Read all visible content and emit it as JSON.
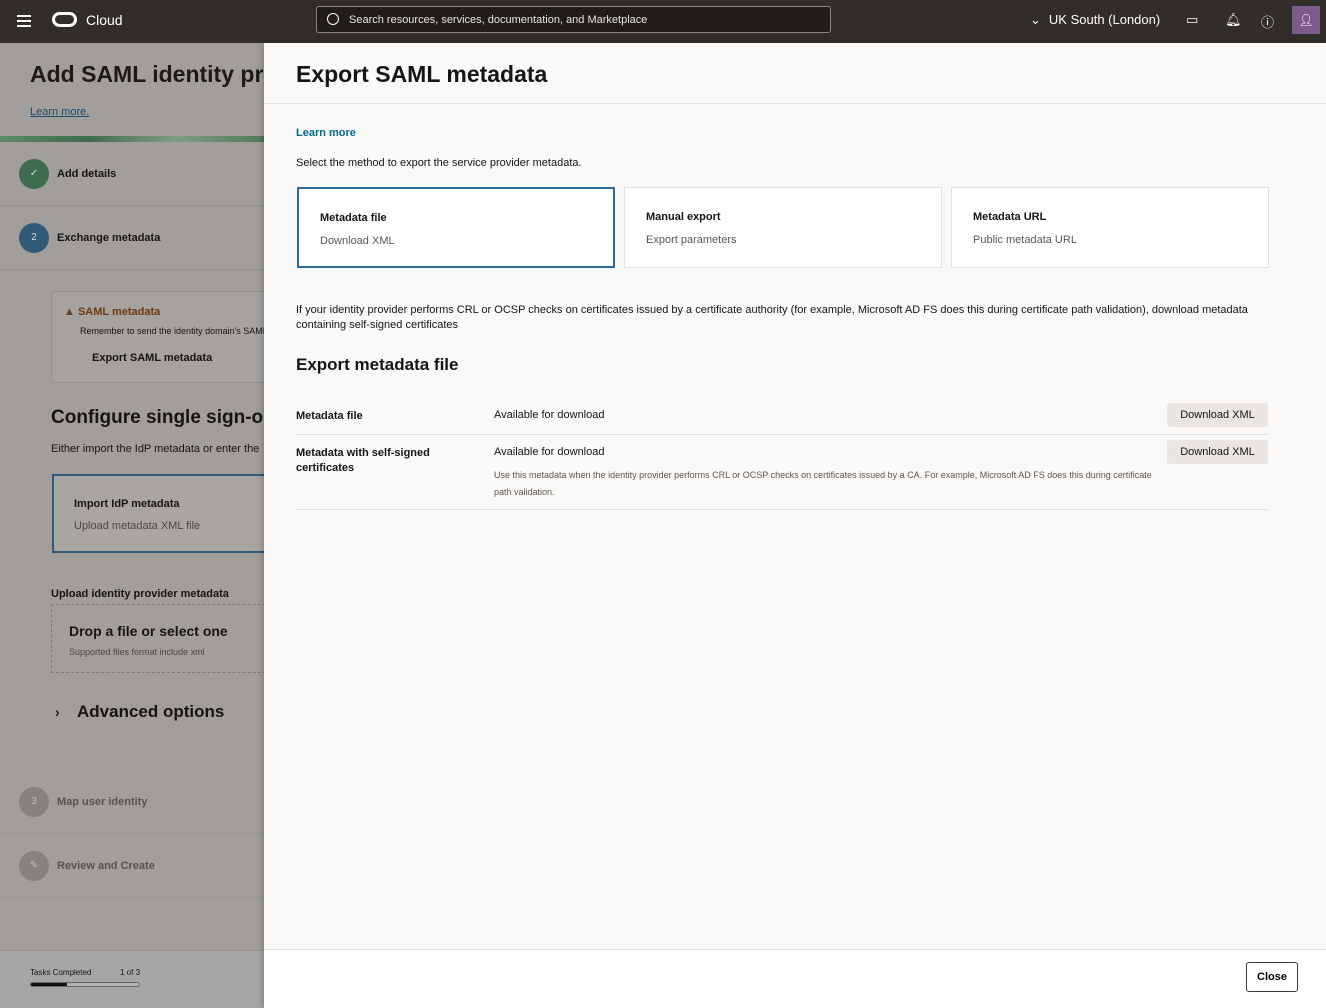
{
  "topbar": {
    "brand": "Cloud",
    "search_placeholder": "Search resources, services, documentation, and Marketplace",
    "region": "UK South (London)",
    "icons": [
      "menu-icon",
      "oracle-logo",
      "search-icon",
      "chevron-down-icon",
      "cloud-shell-icon",
      "bell-icon",
      "help-icon",
      "user-icon"
    ]
  },
  "left": {
    "title": "Add SAML identity provider",
    "learn_more": "Learn more.",
    "steps": [
      {
        "num": "✓",
        "label": "Add details",
        "state": "complete"
      },
      {
        "num": "2",
        "label": "Exchange metadata",
        "state": "current"
      },
      {
        "num": "3",
        "label": "Map user identity",
        "state": "pending"
      },
      {
        "num": "✎",
        "label": "Review and Create",
        "state": "pending"
      }
    ],
    "notice": {
      "title": "SAML metadata",
      "body": "Remember to send the identity domain's SAML metadata",
      "button": "Export SAML metadata"
    },
    "configure_title": "Configure single sign-on",
    "configure_sub": "Either import the IdP metadata or enter the",
    "import_card": {
      "title": "Import IdP metadata",
      "sub": "Upload metadata XML file"
    },
    "upload_label": "Upload identity provider metadata",
    "drop": {
      "title": "Drop a file or select one",
      "sub": "Supported files format include xml"
    },
    "advanced": "Advanced options",
    "footer": {
      "label": "Tasks Completed",
      "count": "1 of 3",
      "progress_fraction": 0.33
    }
  },
  "panel": {
    "title": "Export SAML metadata",
    "learn_more": "Learn more",
    "select_text": "Select the method to export the service provider metadata.",
    "cards": [
      {
        "title": "Metadata file",
        "sub": "Download XML",
        "selected": true
      },
      {
        "title": "Manual export",
        "sub": "Export parameters",
        "selected": false
      },
      {
        "title": "Metadata URL",
        "sub": "Public metadata URL",
        "selected": false
      }
    ],
    "info": "If your identity provider performs CRL or OCSP checks on certificates issued by a certificate authority (for example, Microsoft AD FS does this during certificate path validation), download metadata containing self-signed certificates",
    "section_title": "Export metadata file",
    "rows": [
      {
        "key": "Metadata file",
        "value": "Available for download",
        "button": "Download XML"
      },
      {
        "key": "Metadata with self-signed certificates",
        "value": "Available for download",
        "desc": "Use this metadata when the identity provider performs CRL or OCSP checks on certificates issued by a CA. For example, Microsoft AD FS does this during certificate path validation.",
        "button": "Download XML"
      }
    ],
    "close": "Close"
  },
  "colors": {
    "accent": "#2b6d9e",
    "link": "#00688c",
    "topbar": "#312d2a",
    "complete": "#3f6b4e"
  }
}
